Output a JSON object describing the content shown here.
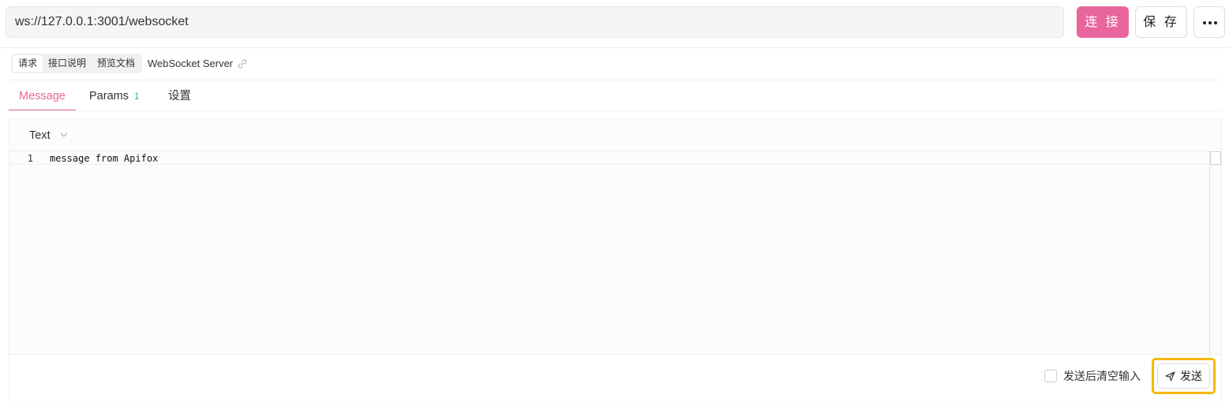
{
  "url_bar": {
    "value": "ws://127.0.0.1:3001/websocket"
  },
  "actions": {
    "connect_label": "连 接",
    "save_label": "保 存"
  },
  "sub_tabs": [
    {
      "label": "请求",
      "active": true
    },
    {
      "label": "接口说明",
      "active": false
    },
    {
      "label": "预览文档",
      "active": false
    }
  ],
  "server_name": "WebSocket Server",
  "tabs": [
    {
      "label": "Message",
      "active": true
    },
    {
      "label": "Params",
      "badge": "1",
      "active": false
    },
    {
      "label": "设置",
      "active": false
    }
  ],
  "editor": {
    "format": "Text",
    "lines": [
      {
        "number": "1",
        "text": "message from Apifox"
      }
    ]
  },
  "footer": {
    "clear_after_send_label": "发送后清空输入",
    "clear_after_send_checked": false,
    "send_label": "发送"
  },
  "colors": {
    "accent": "#e8669d",
    "badge_green": "#43b36b",
    "highlight": "#f5b800"
  },
  "icons": [
    "ellipsis-icon",
    "link-icon",
    "chevron-down-icon",
    "send-icon"
  ]
}
